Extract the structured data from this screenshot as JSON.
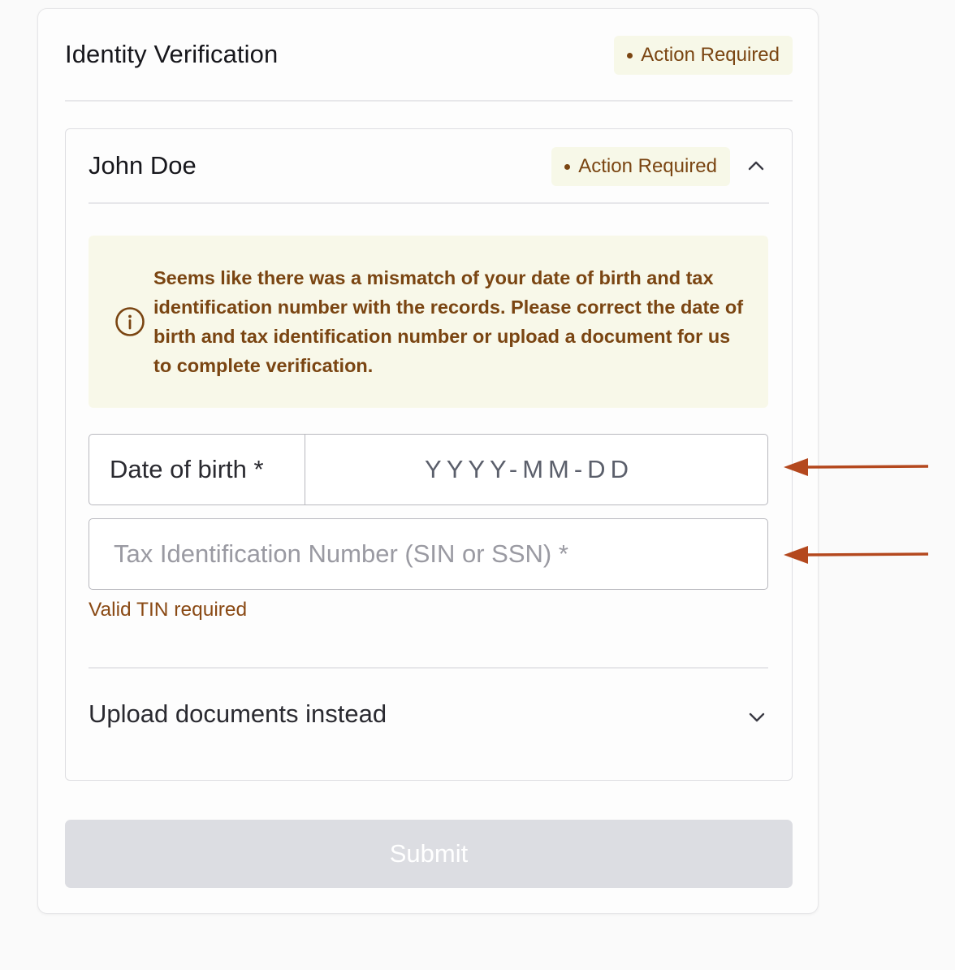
{
  "card": {
    "title": "Identity Verification",
    "status_badge": "Action Required"
  },
  "person": {
    "name": "John Doe",
    "status_badge": "Action Required",
    "expanded": true
  },
  "alert": {
    "icon": "info-circle-icon",
    "message": "Seems like there was a mismatch of your date of birth and tax identification number with the records. Please correct the date of birth and tax identification number or upload a document for us to complete verification."
  },
  "form": {
    "dob": {
      "label": "Date of birth *",
      "placeholder": "YYYY-MM-DD",
      "value": ""
    },
    "tin": {
      "placeholder": "Tax Identification Number (SIN or SSN) *",
      "value": "",
      "error": "Valid TIN required"
    }
  },
  "upload": {
    "label": "Upload documents instead",
    "expanded": false
  },
  "submit": {
    "label": "Submit",
    "disabled": true
  },
  "colors": {
    "badge_bg": "#f7f8e8",
    "badge_text": "#7a4512",
    "alert_bg": "#f8f8e9",
    "annotation_arrow": "#b4481e",
    "submit_disabled_bg": "#dcdde2"
  }
}
